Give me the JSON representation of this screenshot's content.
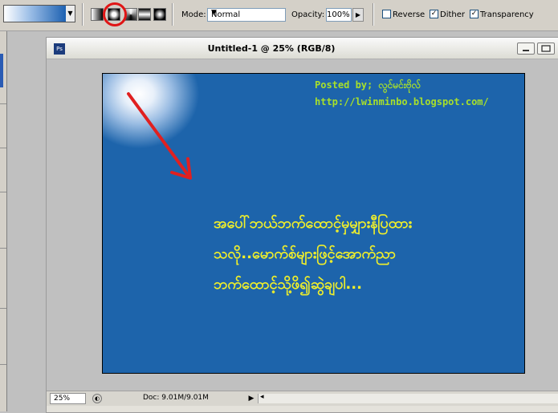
{
  "options_bar": {
    "mode_label": "Mode:",
    "mode_value": "Normal",
    "opacity_label": "Opacity:",
    "opacity_value": "100%",
    "reverse_label": "Reverse",
    "reverse_checked": false,
    "dither_label": "Dither",
    "dither_checked": true,
    "transparency_label": "Transparency",
    "transparency_checked": true,
    "gradient_types": [
      "linear",
      "radial",
      "angle",
      "reflected",
      "diamond"
    ],
    "selected_gradient": "radial",
    "highlight_color": "#e01515"
  },
  "document": {
    "icon_label": "Ps",
    "title": "Untitled-1 @ 25% (RGB/8)",
    "canvas_color": "#1d64ab",
    "posted_by": "Posted by; လွင်မင်းဗိုလ်",
    "url": "http://lwinminbo.blogspot.com/",
    "lines": [
      "အပေါ်ဘယ်ဘက်ထောင့်မှမျှားနီပြထား",
      "သလို..မောက်စ်များဖြင့်အောက်ညာ",
      "ဘက်ထောင့်သို့ဖိ၍ဆွဲချပါ..."
    ],
    "arrow_color": "#e02020"
  },
  "status": {
    "zoom": "25%",
    "doc_info": "Doc: 9.01M/9.01M"
  }
}
